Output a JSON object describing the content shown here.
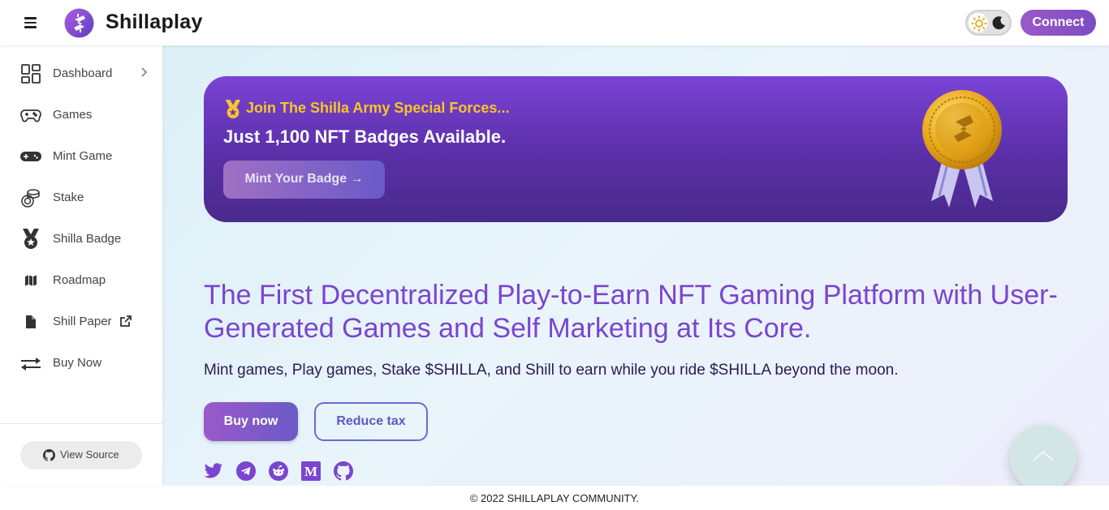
{
  "header": {
    "brand": "Shillaplay",
    "connect_label": "Connect",
    "menu_icon": "hamburger-icon",
    "theme_icons": [
      "sun-icon",
      "moon-icon"
    ]
  },
  "sidebar": {
    "items": [
      {
        "label": "Dashboard",
        "icon": "dashboard-icon"
      },
      {
        "label": "Games",
        "icon": "gamepad-icon"
      },
      {
        "label": "Mint Game",
        "icon": "controller-icon"
      },
      {
        "label": "Stake",
        "icon": "coins-icon"
      },
      {
        "label": "Shilla Badge",
        "icon": "medal-icon"
      },
      {
        "label": "Roadmap",
        "icon": "map-icon"
      },
      {
        "label": "Shill Paper",
        "icon": "document-icon"
      },
      {
        "label": "Buy Now",
        "icon": "exchange-icon"
      }
    ],
    "view_source_label": "View Source"
  },
  "banner": {
    "kicker": "Join The Shilla Army Special Forces...",
    "headline": "Just 1,100 NFT Badges Available.",
    "button_label": "Mint Your Badge →"
  },
  "hero": {
    "title": "The First Decentralized Play-to-Earn NFT Gaming Platform with User-Generated Games and Self Marketing at Its Core.",
    "subtitle": "Mint games, Play games, Stake $SHILLA, and Shill to earn while you ride $SHILLA beyond the moon.",
    "buy_label": "Buy now",
    "tax_label": "Reduce tax"
  },
  "social_icons": [
    "twitter-icon",
    "telegram-icon",
    "reddit-icon",
    "medium-icon",
    "github-icon"
  ],
  "footer": {
    "text": "© 2022 SHILLAPLAY COMMUNITY."
  },
  "colors": {
    "brand_purple": "#7a45cf",
    "banner_top": "#7a43d6",
    "banner_bottom": "#4a2a8c",
    "kicker_yellow": "#f7c628",
    "connect_button": "#8e54c6"
  }
}
